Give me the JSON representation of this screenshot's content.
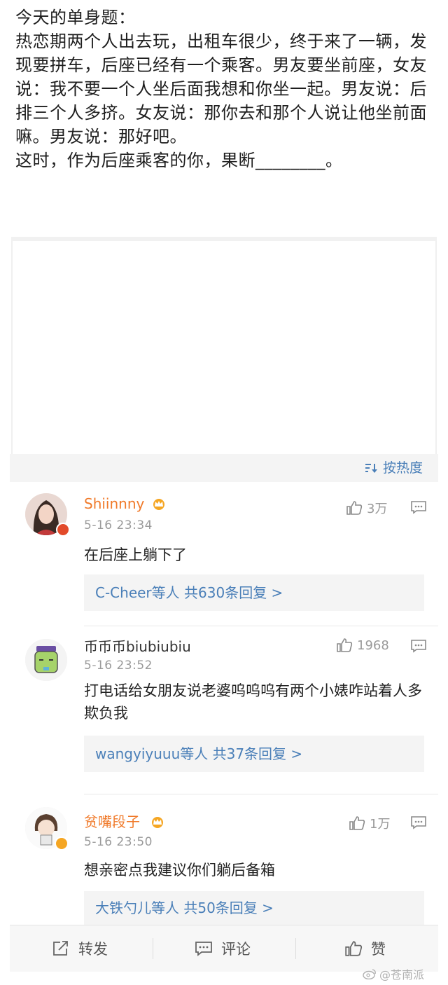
{
  "post": {
    "title": "今天的单身题：",
    "body": "热恋期两个人出去玩，出租车很少，终于来了一辆，发现要拼车，后座已经有一个乘客。男友要坐前座，女友说：我不要一个人坐后面我想和你坐一起。男友说：后排三个人多挤。女友说：那你去和那个人说让他坐前面嘛。男友说：那好吧。\n这时，作为后座乘客的你，果断________。"
  },
  "sort": {
    "label": "按热度"
  },
  "comments": [
    {
      "user": "Shiinnny",
      "time": "5-16 23:34",
      "likes": "3万",
      "text": "在后座上躺下了",
      "reply_names": "C-Cheer等人",
      "reply_count": "共630条回复 >"
    },
    {
      "user": "币币币biubiubiu",
      "time": "5-16 23:52",
      "likes": "1968",
      "text": "打电话给女朋友说老婆呜呜呜有两个小婊咋站着人多欺负我",
      "reply_names": "wangyiyuuu等人",
      "reply_count": "共37条回复 >"
    },
    {
      "user": "贫嘴段子",
      "time": "5-16 23:50",
      "likes": "1万",
      "text": "想亲密点我建议你们躺后备箱",
      "reply_names": "大铁勺儿等人",
      "reply_count": "共50条回复 >"
    }
  ],
  "actions": {
    "repost": "转发",
    "comment": "评论",
    "like": "赞"
  },
  "watermark": "@苍南派",
  "colors": {
    "link": "#4a7fb8",
    "vip_name": "#f07a2a",
    "muted": "#9a9a9a"
  }
}
